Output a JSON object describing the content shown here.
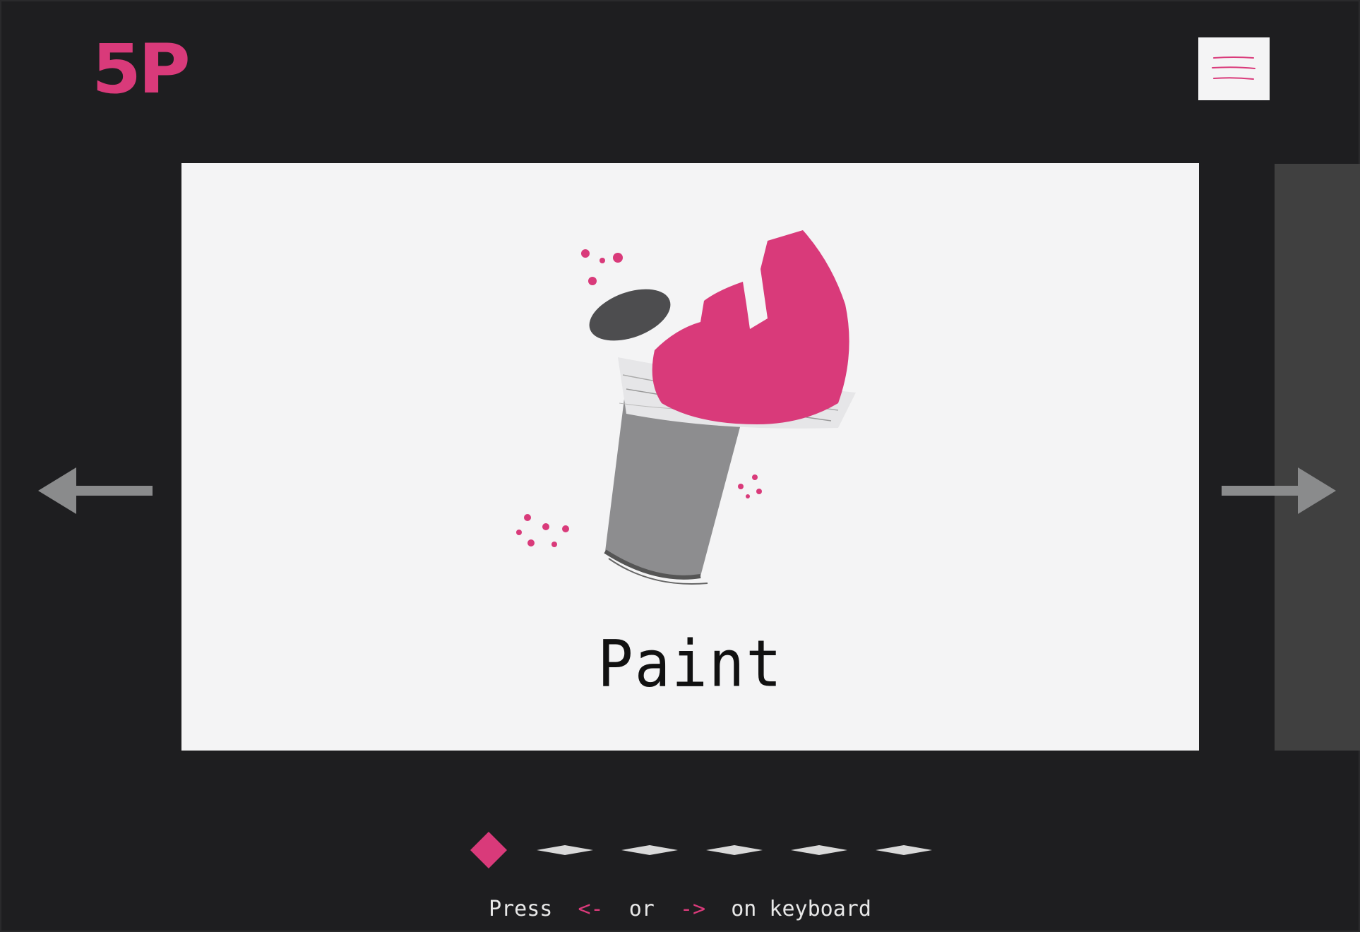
{
  "brand": {
    "logo_text": "5P",
    "accent_color": "#d93a7a"
  },
  "header": {
    "menu_icon": "hamburger-menu-icon"
  },
  "slider": {
    "current_slide": {
      "title": "Paint",
      "illustration": "paint-bucket-illustration"
    },
    "prev_icon": "arrow-left-icon",
    "next_icon": "arrow-right-icon",
    "pagination": {
      "total": 6,
      "active_index": 0
    }
  },
  "hint": {
    "press": "Press",
    "left_key": "<-",
    "or": "or",
    "right_key": "->",
    "suffix": "on keyboard"
  }
}
